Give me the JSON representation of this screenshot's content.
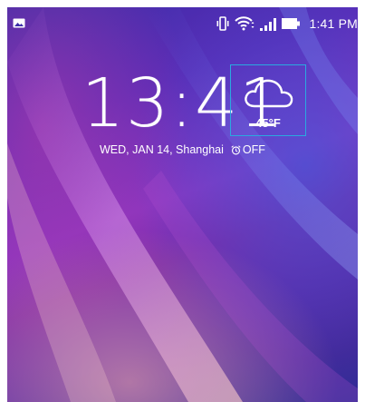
{
  "status_bar": {
    "left_icon": "image-notification-icon",
    "icons": [
      "vibrate-icon",
      "wifi-icon",
      "signal-icon",
      "battery-icon"
    ],
    "time": "1:41 PM"
  },
  "lock_screen": {
    "clock": "13:41",
    "weather": {
      "icon": "cloud-icon",
      "temperature": "45°F"
    },
    "date": "WED, JAN 14, Shanghai",
    "alarm": {
      "icon": "alarm-clock-icon",
      "label": "OFF"
    }
  },
  "colors": {
    "weather_border": "#2aa9e0",
    "text": "#ffffff"
  }
}
